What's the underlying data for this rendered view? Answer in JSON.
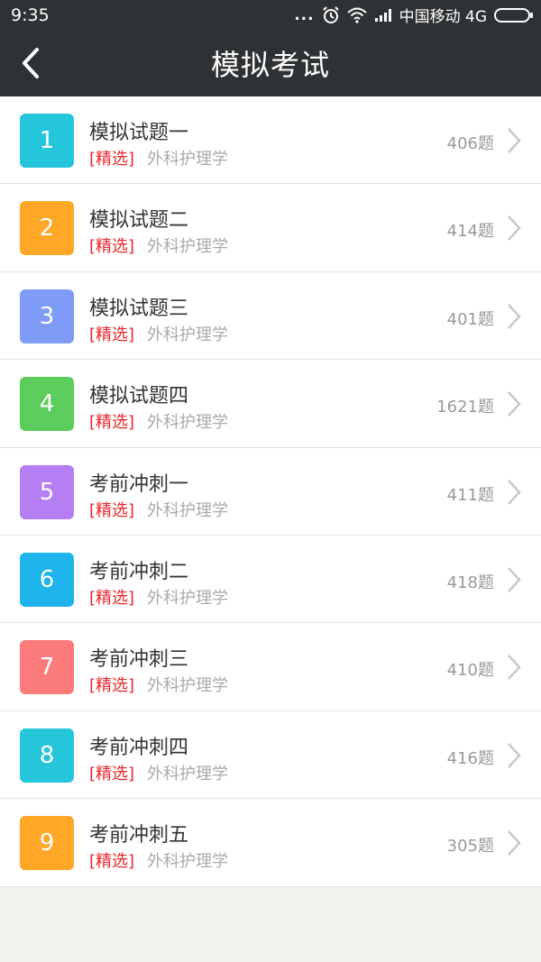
{
  "status": {
    "time": "9:35",
    "dots": "...",
    "carrier": "中国移动 4G"
  },
  "header": {
    "title": "模拟考试"
  },
  "colors": {
    "c1": "#26c6da",
    "c2": "#ffa726",
    "c3": "#7e9cf7",
    "c4": "#5ccc5c",
    "c5": "#b57ef2",
    "c6": "#1fb4ec",
    "c7": "#fc7b7b",
    "c8": "#26c6da",
    "c9": "#ffa726"
  },
  "items": [
    {
      "num": "1",
      "name": "模拟试题一",
      "tag": "[精选]",
      "subject": "外科护理学",
      "count": "406题"
    },
    {
      "num": "2",
      "name": "模拟试题二",
      "tag": "[精选]",
      "subject": "外科护理学",
      "count": "414题"
    },
    {
      "num": "3",
      "name": "模拟试题三",
      "tag": "[精选]",
      "subject": "外科护理学",
      "count": "401题"
    },
    {
      "num": "4",
      "name": "模拟试题四",
      "tag": "[精选]",
      "subject": "外科护理学",
      "count": "1621题"
    },
    {
      "num": "5",
      "name": "考前冲刺一",
      "tag": "[精选]",
      "subject": "外科护理学",
      "count": "411题"
    },
    {
      "num": "6",
      "name": "考前冲刺二",
      "tag": "[精选]",
      "subject": "外科护理学",
      "count": "418题"
    },
    {
      "num": "7",
      "name": "考前冲刺三",
      "tag": "[精选]",
      "subject": "外科护理学",
      "count": "410题"
    },
    {
      "num": "8",
      "name": "考前冲刺四",
      "tag": "[精选]",
      "subject": "外科护理学",
      "count": "416题"
    },
    {
      "num": "9",
      "name": "考前冲刺五",
      "tag": "[精选]",
      "subject": "外科护理学",
      "count": "305题"
    }
  ]
}
